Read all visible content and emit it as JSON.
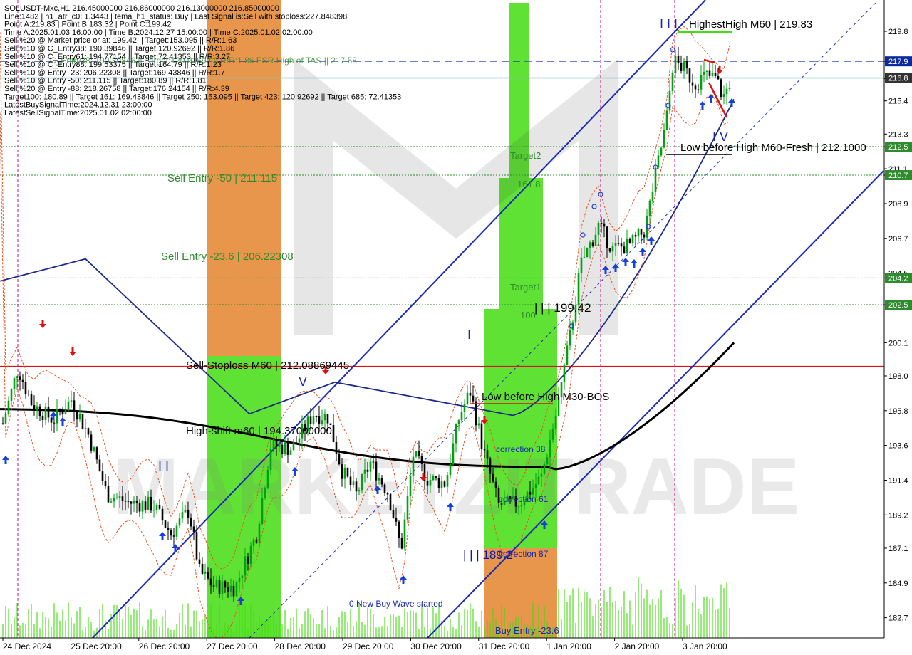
{
  "header": {
    "lines": [
      "SOLUSDT-Mxc,H1  216.45000000 216.86000000 216.13000000 216.85000000",
      "Line:1482 | h1_atr_c0: 1.3443 | tema_h1_status: Buy | Last Signal is:Sell with stoploss:227.848398",
      "Point A:219.83 | Point B:183.32 | Point C:199.42",
      "Time A:2025.01.03 16:00:00 | Time B:2024.12.27 15:00:00 | Time C:2025.01.02 02:00:00",
      "Sell %20 @ Market price or at: 199.42 || Target:153.095 || R/R:1.63",
      "Sell %10 @ C_Entry38: 190.39846 || Target:120.92692 || R/R:1.86",
      "Sell %10 @ C_Entry61: 194.77154 || Target:72.41353 || R/R:3.27",
      "Sell %10 @ C_Entry88: 199.53375 || Target:164.79 || R/R:1.23",
      "Sell %10 @ Entry -23: 206.22308 || Target:169.43846 || R/R:1.7",
      "Sell %10 @ Entry -50: 211.115 || Target:180.89 || R/R:1.81",
      "Sell %20 @ Entry -88: 218.26758 || Target:176.24154 || R/R:4.39",
      "Target100: 180.89 || Target 161: 169.43846 || Target 250: 153.095 || Target 423: 120.92692 || Target 685: 72.41353",
      "LatestBuySignalTime:2024.12.31 23:00:00",
      "LatestSellSignalTime:2025.01.02 02:00:00"
    ],
    "overlap_text": "C_Entry38: 190.39846 || Target:120.92692 || R/R:1.86   ESR High of TAS || 217.58"
  },
  "chart_data": {
    "type": "candlestick",
    "symbol": "SOLUSDT-Mxc",
    "timeframe": "H1",
    "ylim": [
      182.0,
      221.4
    ],
    "y_ticks": [
      "219.8",
      "217.9",
      "216.8",
      "215.4",
      "213.3",
      "212.5",
      "211.1",
      "210.7",
      "208.9",
      "206.7",
      "204.5",
      "204.2",
      "202.5",
      "200.1",
      "198.0",
      "195.8",
      "193.6",
      "191.4",
      "189.2",
      "187.1",
      "184.9",
      "182.7"
    ],
    "x_ticks": [
      "24 Dec 2024",
      "25 Dec 20:00",
      "26 Dec 20:00",
      "27 Dec 20:00",
      "28 Dec 20:00",
      "29 Dec 20:00",
      "30 Dec 20:00",
      "31 Dec 20:00",
      "1 Jan 20:00",
      "2 Jan 20:00",
      "3 Jan 20:00"
    ],
    "price_tags": [
      {
        "label": "217.9",
        "value": 217.9,
        "color": "#0a2a9e"
      },
      {
        "label": "216.8",
        "value": 216.85,
        "color": "#333333"
      },
      {
        "label": "212.5",
        "value": 212.5,
        "color": "#2e8b2e"
      },
      {
        "label": "210.7",
        "value": 210.7,
        "color": "#2e8b2e"
      },
      {
        "label": "204.2",
        "value": 204.2,
        "color": "#2e8b2e"
      },
      {
        "label": "202.5",
        "value": 202.5,
        "color": "#2e8b2e"
      }
    ],
    "levels": [
      {
        "value": 217.9,
        "color": "#1c2fb0",
        "style": "dashed"
      },
      {
        "value": 216.85,
        "color": "#88bbbb",
        "style": "solid"
      },
      {
        "value": 212.5,
        "color": "#2e8b2e",
        "style": "dotted"
      },
      {
        "value": 210.7,
        "color": "#2e8b2e",
        "style": "dotted"
      },
      {
        "value": 204.2,
        "color": "#2e8b2e",
        "style": "dotted"
      },
      {
        "value": 202.5,
        "color": "#2e8b2e",
        "style": "dotted"
      },
      {
        "value": 198.6,
        "color": "#dd1111",
        "style": "solid"
      }
    ],
    "annotations": [
      {
        "text": "HighestHigh   M60 | 219.83",
        "color": "#000000"
      },
      {
        "text": "Low before High   M60-Fresh | 212.1000",
        "color": "#000000"
      },
      {
        "text": "Sell Entry -50 | 211.115",
        "color": "#2e8b2e"
      },
      {
        "text": "Sell Entry -23.6 | 206.22308",
        "color": "#2e8b2e"
      },
      {
        "text": "Sell-Stoploss M60 | 212.08869445",
        "color": "#000000"
      },
      {
        "text": "High-shift m60 | 194.37000000",
        "color": "#000000"
      },
      {
        "text": "Low before High   M30-BOS",
        "color": "#000000"
      },
      {
        "text": "| | | 199.42",
        "color": "#000000"
      },
      {
        "text": "| | | 189.2",
        "color": "#0a1aaa"
      },
      {
        "text": "Target2",
        "color": "#2e8b2e"
      },
      {
        "text": "161.8",
        "color": "#2e8b2e"
      },
      {
        "text": "Target1",
        "color": "#2e8b2e"
      },
      {
        "text": "100",
        "color": "#2e8b2e"
      },
      {
        "text": "correction 38",
        "color": "#1a2ab0"
      },
      {
        "text": "correction 61",
        "color": "#1a2ab0"
      },
      {
        "text": "correction 87",
        "color": "#1a2ab0"
      },
      {
        "text": "0 New Buy Wave started",
        "color": "#1a2ab0"
      },
      {
        "text": "Buy Entry -23.6",
        "color": "#1a2ab0"
      },
      {
        "text": "I",
        "color": "#1a2ab0"
      },
      {
        "text": "V",
        "color": "#1a2ab0"
      },
      {
        "text": "I I",
        "color": "#1a2ab0"
      },
      {
        "text": "I I I",
        "color": "#1a2ab0"
      },
      {
        "text": "I V",
        "color": "#1a2ab0"
      }
    ],
    "watermark": "MARKETZITRADE",
    "colors": {
      "bull": "#00a010",
      "bear": "#000000",
      "channel": "#1a2ab8",
      "ma_slow": "#000000",
      "ma_band": "#1c2a8c",
      "signal_buy": "#1640d8",
      "signal_sell": "#e01010",
      "zone_green": "#44dd11",
      "zone_orange": "#e07818"
    }
  }
}
